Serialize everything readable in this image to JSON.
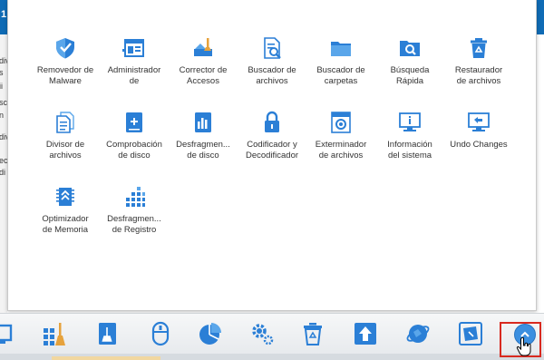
{
  "background": {
    "title_fragment": "1",
    "left_text_fragments": [
      "div",
      "s",
      "ii",
      "sc",
      "n",
      "div",
      "ec",
      "di"
    ]
  },
  "tools": [
    {
      "label": "Removedor de\nMalware",
      "icon": "shield-icon"
    },
    {
      "label": "Administrador\nde",
      "icon": "startup-manager-icon"
    },
    {
      "label": "Corrector de\nAccesos",
      "icon": "shortcut-fixer-icon"
    },
    {
      "label": "Buscador de\narchivos",
      "icon": "file-search-icon"
    },
    {
      "label": "Buscador de\ncarpetas",
      "icon": "folder-search-icon"
    },
    {
      "label": "Búsqueda\nRápida",
      "icon": "quick-search-folder-icon"
    },
    {
      "label": "Restaurador\nde archivos",
      "icon": "recycle-bin-icon"
    },
    {
      "label": "Divisor de\narchivos",
      "icon": "file-split-icon"
    },
    {
      "label": "Comprobación\nde disco",
      "icon": "disk-check-icon"
    },
    {
      "label": "Desfragmen...\nde disco",
      "icon": "disk-defrag-icon"
    },
    {
      "label": "Codificador y\nDecodificador",
      "icon": "lock-icon"
    },
    {
      "label": "Exterminador\nde archivos",
      "icon": "file-shredder-icon"
    },
    {
      "label": "Información\ndel sistema",
      "icon": "system-info-icon"
    },
    {
      "label": "Undo Changes",
      "icon": "undo-changes-icon"
    },
    {
      "label": "Optimizador\nde Memoria",
      "icon": "memory-chip-icon"
    },
    {
      "label": "Desfragmen...\nde Registro",
      "icon": "registry-defrag-icon"
    }
  ],
  "toolbar": [
    {
      "icon": "screen-icon"
    },
    {
      "icon": "clean-icon"
    },
    {
      "icon": "disk-cleaner-icon"
    },
    {
      "icon": "mouse-icon"
    },
    {
      "icon": "pie-chart-icon"
    },
    {
      "icon": "settings-icon"
    },
    {
      "icon": "trash-icon"
    },
    {
      "icon": "upgrade-icon"
    },
    {
      "icon": "internet-icon"
    },
    {
      "icon": "restore-icon"
    }
  ],
  "expand_button": {
    "icon": "chevron-up-icon"
  },
  "colors": {
    "accent": "#2b7fd6",
    "highlight": "#d8291f",
    "label": "#333333"
  }
}
